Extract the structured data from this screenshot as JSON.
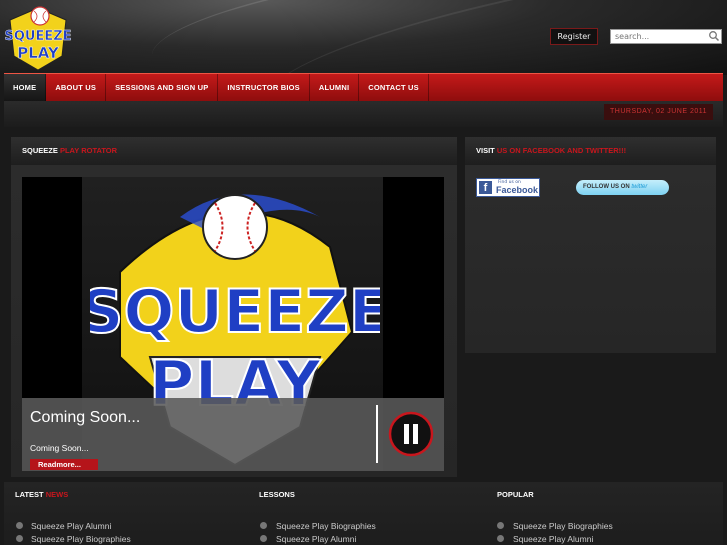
{
  "header": {
    "logo_text": [
      "SQUEEZE",
      "PLAY"
    ],
    "register_label": "Register",
    "search_placeholder": "search..."
  },
  "nav": {
    "items": [
      "HOME",
      "ABOUT US",
      "SESSIONS AND SIGN UP",
      "INSTRUCTOR BIOS",
      "ALUMNI",
      "CONTACT US"
    ],
    "active_index": 0
  },
  "date": "THURSDAY, 02 JUNE 2011",
  "rotator": {
    "heading_white": "SQUEEZE",
    "heading_red": "PLAY ROTATOR",
    "image_text": [
      "SQUEEZE",
      "PLAY"
    ],
    "caption_title": "Coming Soon...",
    "caption_text": "Coming Soon...",
    "readmore_label": "Readmore..."
  },
  "social": {
    "heading_white": "VISIT",
    "heading_red": "US ON FACEBOOK AND TWITTER!!!",
    "facebook_small": "Find us on",
    "facebook_big": "Facebook",
    "twitter_label": "FOLLOW US ON",
    "twitter_brand": "twitter"
  },
  "bottom": {
    "latest": {
      "heading_white": "LATEST",
      "heading_red": "NEWS",
      "items": [
        "Squeeze Play Alumni",
        "Squeeze Play Biographies"
      ]
    },
    "lessons": {
      "heading": "LESSONS",
      "items": [
        "Squeeze Play Biographies",
        "Squeeze Play Alumni"
      ]
    },
    "popular": {
      "heading": "POPULAR",
      "items": [
        "Squeeze Play Biographies",
        "Squeeze Play Alumni"
      ]
    }
  },
  "colors": {
    "accent_red": "#c8161d",
    "nav_red": "#b31414",
    "background": "#1a1a1a",
    "logo_blue": "#1f3fc4",
    "logo_yellow": "#f2d21b"
  }
}
